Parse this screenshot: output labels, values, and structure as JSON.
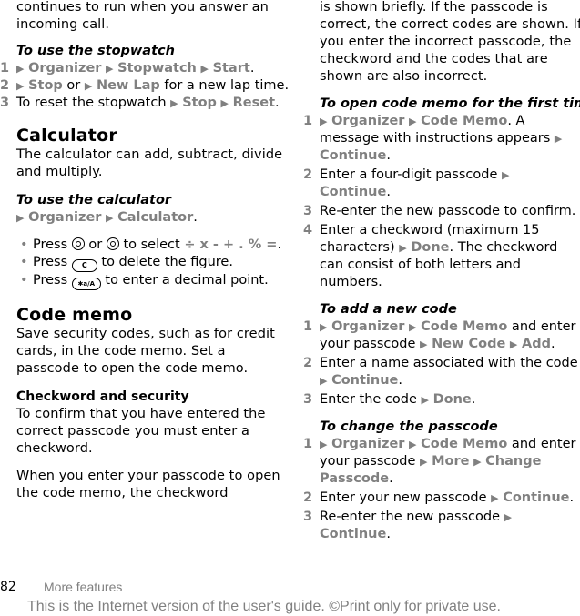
{
  "left": {
    "intro": "continues to run when you answer an incoming call.",
    "stopwatch": {
      "heading": "To use the stopwatch",
      "step1": {
        "num": "1",
        "m1": "Organizer",
        "m2": "Stopwatch",
        "m3": "Start",
        "end": "."
      },
      "step2": {
        "num": "2",
        "m1": "Stop",
        "t1": " or ",
        "m2": "New Lap",
        "t2": " for a new lap time."
      },
      "step3": {
        "num": "3",
        "t1": "To reset the stopwatch ",
        "m1": "Stop",
        "m2": "Reset",
        "end": "."
      }
    },
    "calculator": {
      "heading": "Calculator",
      "desc": "The calculator can add, subtract, divide and multiply.",
      "subheading": "To use the calculator",
      "path": {
        "m1": "Organizer",
        "m2": "Calculator",
        "end": "."
      },
      "bullets": [
        {
          "t1": "Press ",
          "or": " or ",
          "t2": " to select ",
          "ops": "÷ x - + . % =",
          "end": "."
        },
        {
          "t1": "Press ",
          "key": "C",
          "t2": " to delete the figure."
        },
        {
          "t1": "Press ",
          "key": "✱a/A",
          "t2": " to enter a decimal point."
        }
      ]
    },
    "code_memo": {
      "heading": "Code memo",
      "desc": "Save security codes, such as for credit cards, in the code memo. Set a passcode to open the code memo.",
      "subheading": "Checkword and security",
      "p1": "To confirm that you have entered the correct passcode you must enter a checkword.",
      "p2": "When you enter your passcode to open the code memo, the checkword"
    }
  },
  "right": {
    "intro": "is shown briefly. If the passcode is correct, the correct codes are shown. If you enter the incorrect passcode, the checkword and the codes that are shown are also incorrect.",
    "first_time": {
      "heading": "To open code memo for the first time",
      "step1": {
        "num": "1",
        "m1": "Organizer",
        "m2": "Code Memo",
        "t1": ". A message with instructions appears ",
        "m3": "Continue",
        "end": "."
      },
      "step2": {
        "num": "2",
        "t1": "Enter a four-digit passcode ",
        "m1": "Continue",
        "end": "."
      },
      "step3": {
        "num": "3",
        "t1": "Re-enter the new passcode to confirm."
      },
      "step4": {
        "num": "4",
        "t1": "Enter a checkword (maximum 15 characters) ",
        "m1": "Done",
        "t2": ". The checkword can consist of both letters and numbers."
      }
    },
    "add_code": {
      "heading": "To add a new code",
      "step1": {
        "num": "1",
        "m1": "Organizer",
        "m2": "Code Memo",
        "t1": " and enter your passcode ",
        "m3": "New Code",
        "m4": "Add",
        "end": "."
      },
      "step2": {
        "num": "2",
        "t1": "Enter a name associated with the code ",
        "m1": "Continue",
        "end": "."
      },
      "step3": {
        "num": "3",
        "t1": "Enter the code ",
        "m1": "Done",
        "end": "."
      }
    },
    "change_passcode": {
      "heading": "To change the passcode",
      "step1": {
        "num": "1",
        "m1": "Organizer",
        "m2": "Code Memo",
        "t1": " and enter your passcode ",
        "m3": "More",
        "m4": "Change Passcode",
        "end": "."
      },
      "step2": {
        "num": "2",
        "t1": "Enter your new passcode ",
        "m1": "Continue",
        "end": "."
      },
      "step3": {
        "num": "3",
        "t1": "Re-enter the new passcode ",
        "m1": "Continue",
        "end": "."
      }
    }
  },
  "footer": {
    "page_number": "82",
    "section": "More features",
    "note": "This is the Internet version of the user's guide. ©Print only for private use."
  },
  "icons": {
    "arrow": "▶"
  }
}
